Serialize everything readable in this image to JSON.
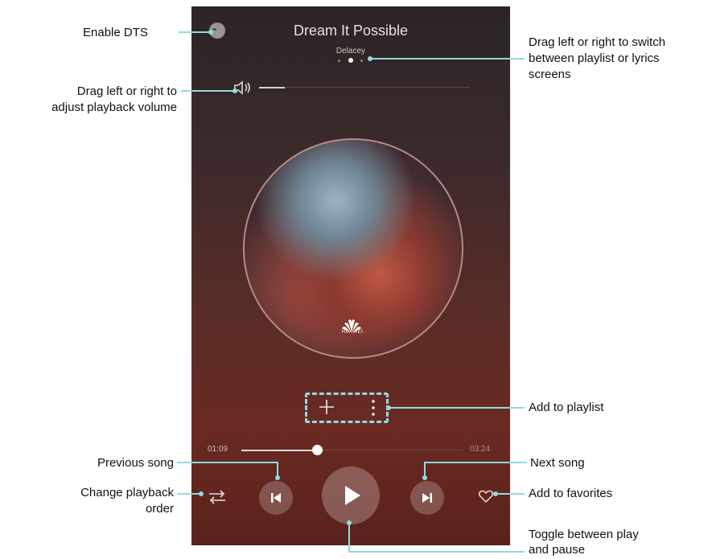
{
  "player": {
    "song_title": "Dream It Possible",
    "artist": "Delacey",
    "current_time": "01:09",
    "total_time": "03:24",
    "progress": 0.34,
    "volume": 0.12,
    "album_brand": "HUAWEI",
    "page_indicator": {
      "count": 3,
      "active": 2
    }
  },
  "icons": {
    "dts": "dts-icon",
    "volume": "speaker-icon",
    "add": "plus-icon",
    "more": "more-vertical-icon",
    "order": "shuffle-order-icon",
    "previous": "skip-previous-icon",
    "play": "play-icon",
    "next": "skip-next-icon",
    "favorite": "heart-icon"
  },
  "annotations": {
    "enable_dts": "Enable DTS",
    "volume_line1": "Drag left or right to",
    "volume_line2": "adjust playback volume",
    "switch_line1": "Drag left or right to switch",
    "switch_line2": "between playlist or lyrics",
    "switch_line3": "screens",
    "add_playlist": "Add to playlist",
    "previous_song": "Previous song",
    "next_song": "Next song",
    "order_line1": "Change playback",
    "order_line2": "order",
    "favorites": "Add to favorites",
    "toggle_line1": "Toggle between play",
    "toggle_line2": "and pause"
  },
  "colors": {
    "callout_line": "#8fdbe0",
    "background_top": "#2b2426",
    "background_bottom": "#5a221c"
  }
}
